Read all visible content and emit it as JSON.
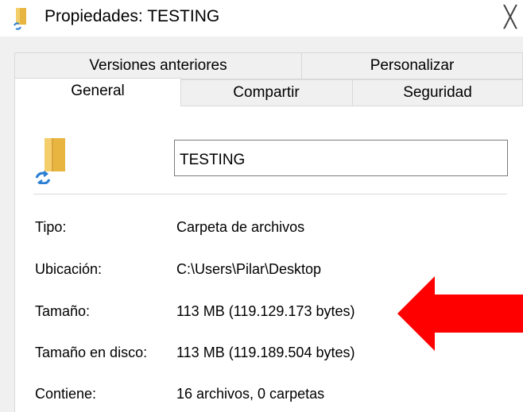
{
  "window": {
    "title": "Propiedades: TESTING",
    "close_glyph": "╳"
  },
  "tabs": {
    "row1": [
      {
        "label": "Versiones anteriores"
      },
      {
        "label": "Personalizar"
      }
    ],
    "row2": [
      {
        "label": "General",
        "active": true
      },
      {
        "label": "Compartir"
      },
      {
        "label": "Seguridad"
      }
    ]
  },
  "general": {
    "folder_icon": "folder-shared-icon",
    "name_value": "TESTING",
    "properties": [
      {
        "label": "Tipo:",
        "value": "Carpeta de archivos"
      },
      {
        "label": "Ubicación:",
        "value": "C:\\Users\\Pilar\\Desktop"
      },
      {
        "label": "Tamaño:",
        "value": "113 MB (119.129.173 bytes)"
      },
      {
        "label": "Tamaño en disco:",
        "value": "113 MB (119.189.504 bytes)"
      },
      {
        "label": "Contiene:",
        "value": "16 archivos, 0 carpetas"
      }
    ]
  },
  "annotation": {
    "arrow_icon": "red-arrow-icon",
    "arrow_color": "#ff0000"
  }
}
